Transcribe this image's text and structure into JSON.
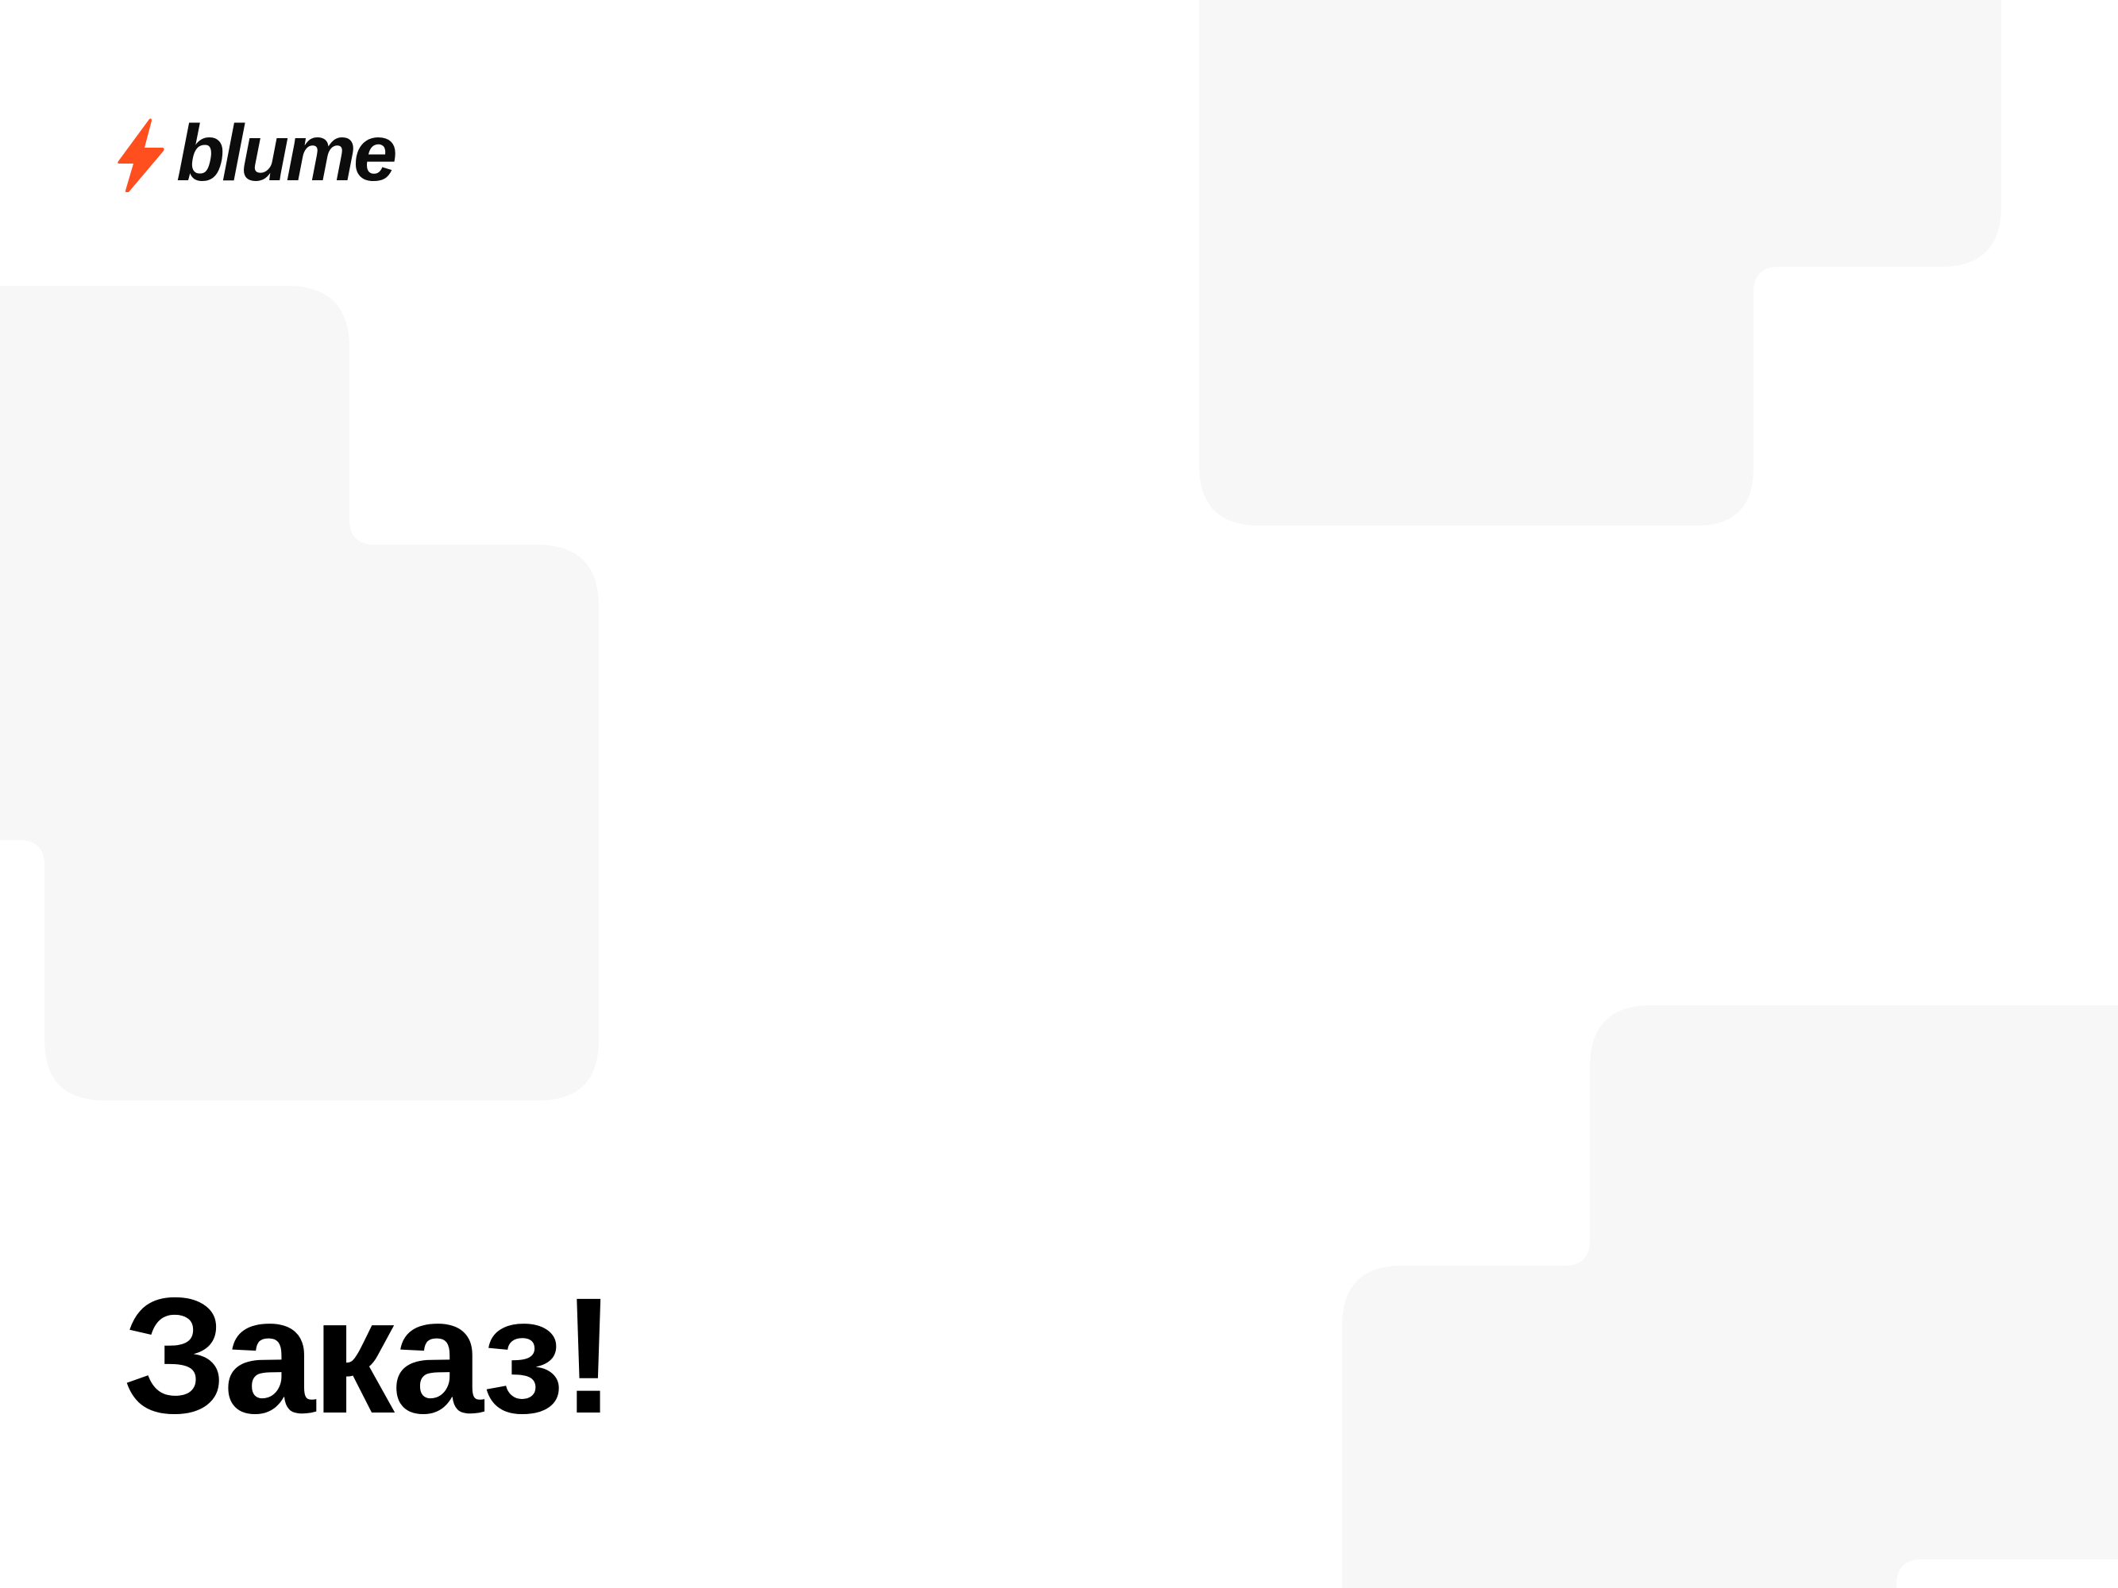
{
  "brand": {
    "name": "blume",
    "bolt_color": "#ff4f1f",
    "text_color": "#0c0c0c"
  },
  "headline": {
    "text": "Заказ!"
  },
  "background": {
    "page_color": "#ffffff",
    "shape_color": "#f7f7f7"
  }
}
